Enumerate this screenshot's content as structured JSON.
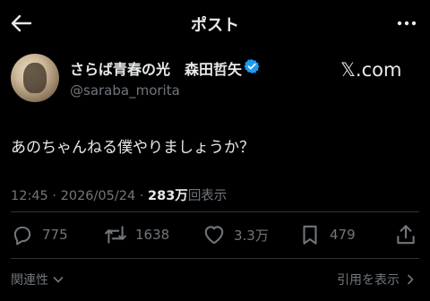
{
  "header": {
    "title": "ポスト",
    "back_icon": "arrow-left-icon",
    "more_icon": "more-horizontal-icon"
  },
  "author": {
    "display_name": "さらば青春の光　森田哲矢",
    "handle": "@saraba_morita",
    "verified": true,
    "verified_color": "#1d9bf0"
  },
  "watermark": "𝕏.com",
  "post": {
    "text": "あのちゃんねる僕やりましょうか？",
    "time": "12:45",
    "date": "2026/05/24",
    "views_count": "283万",
    "views_label": "回表示"
  },
  "actions": {
    "replies": "775",
    "reposts": "1638",
    "likes": "3.3万",
    "bookmarks": "479"
  },
  "footer": {
    "related_label": "関連性",
    "quotes_label": "引用を表示"
  },
  "colors": {
    "background": "#000000",
    "text": "#e7e9ea",
    "muted": "#71767b",
    "divider": "#2f3336"
  }
}
